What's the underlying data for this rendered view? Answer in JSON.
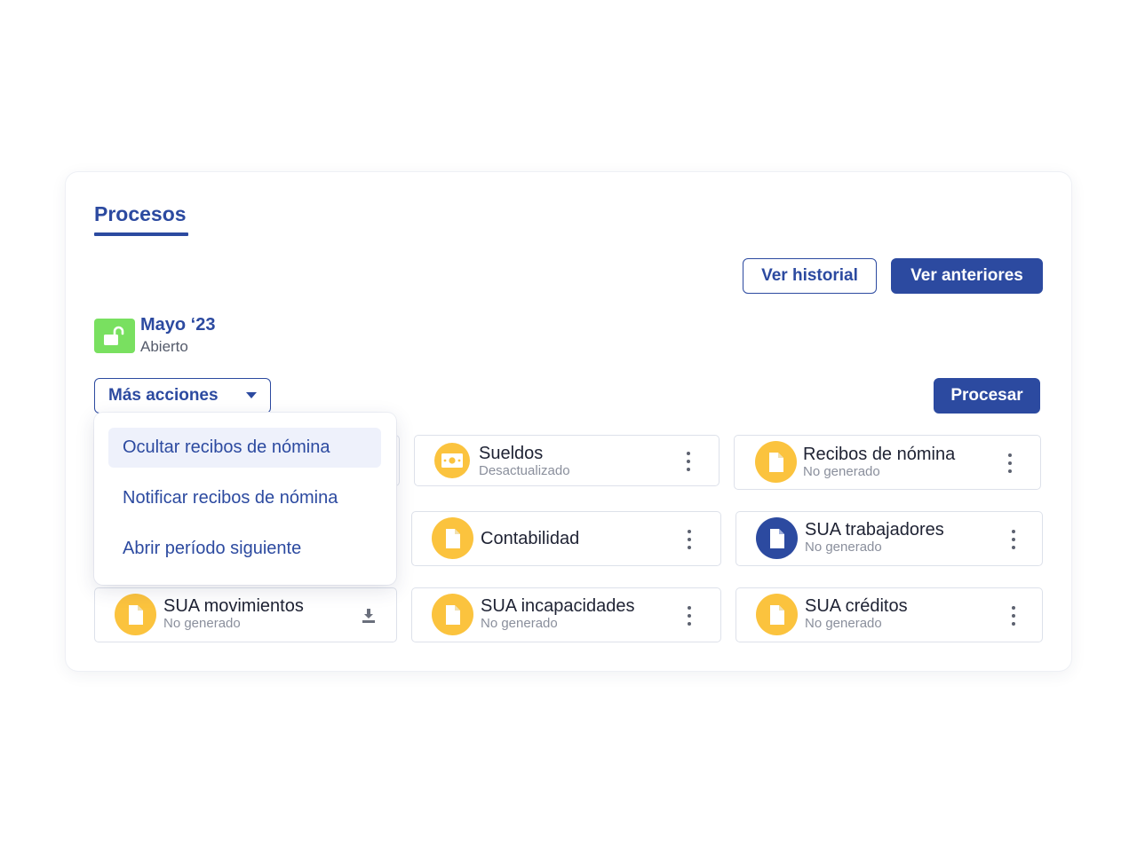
{
  "tab": {
    "title": "Procesos"
  },
  "header_buttons": {
    "history": "Ver historial",
    "previous": "Ver anteriores"
  },
  "period": {
    "name": "Mayo ‘23",
    "status": "Abierto",
    "icon": "unlock-icon",
    "status_color": "#79e060"
  },
  "actions": {
    "more_label": "Más acciones",
    "process_label": "Procesar"
  },
  "dropdown": {
    "items": [
      {
        "label": "Ocultar recibos de nómina",
        "highlighted": true
      },
      {
        "label": "Notificar recibos de nómina",
        "highlighted": false
      },
      {
        "label": "Abrir período siguiente",
        "highlighted": false
      }
    ]
  },
  "tiles": [
    {
      "title": "Sueldos",
      "subtitle": "Desactualizado",
      "icon": "money-icon",
      "icon_color": "#fbc33e",
      "action": "more-menu"
    },
    {
      "title": "Recibos de nómina",
      "subtitle": "No generado",
      "icon": "document-icon",
      "icon_color": "#fbc33e",
      "action": "more-menu"
    },
    {
      "title": "Contabilidad",
      "subtitle": "",
      "icon": "document-icon",
      "icon_color": "#fbc33e",
      "action": "more-menu"
    },
    {
      "title": "SUA trabajadores",
      "subtitle": "No generado",
      "icon": "document-icon",
      "icon_color": "#2c4aa0",
      "action": "more-menu"
    },
    {
      "title": "SUA movimientos",
      "subtitle": "No generado",
      "icon": "document-icon",
      "icon_color": "#fbc33e",
      "action": "download"
    },
    {
      "title": "SUA incapacidades",
      "subtitle": "No generado",
      "icon": "document-icon",
      "icon_color": "#fbc33e",
      "action": "more-menu"
    },
    {
      "title": "SUA créditos",
      "subtitle": "No generado",
      "icon": "document-icon",
      "icon_color": "#fbc33e",
      "action": "more-menu"
    }
  ],
  "colors": {
    "primary": "#2c4aa0",
    "warning": "#fbc33e",
    "success": "#79e060",
    "border": "#dde1ea"
  }
}
